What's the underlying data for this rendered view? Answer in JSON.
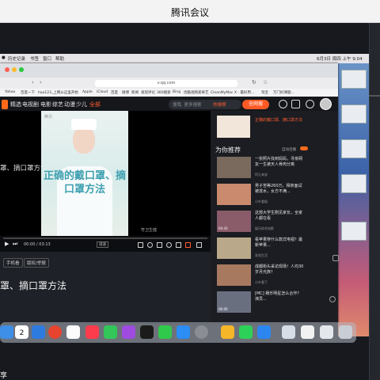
{
  "meeting": {
    "title": "腾讯会议"
  },
  "mac_menubar": {
    "items": [
      "历史记录",
      "书签",
      "窗口",
      "帮助"
    ],
    "clock": "6月3日 周四 上午 9:04"
  },
  "browser": {
    "url": "v.qq.com",
    "bookmarks": [
      "Yahoo",
      "百度一下",
      "hao123_上网从这里开始",
      "Apple",
      "iCloud",
      "百度",
      "微博",
      "新闻",
      "发现评论",
      "360搜索",
      "Bing",
      "优酷视频",
      "爱奇艺",
      "CleanMyMac X - 最好用...",
      "淘宝",
      "万门好课题..."
    ]
  },
  "nav": {
    "items": [
      "精选",
      "电视剧",
      "电影",
      "综艺",
      "动漫",
      "少儿",
      "全部"
    ],
    "search_placeholder": "搜我, 更多搜索",
    "search_hot": "热搜榜",
    "search_button": "全网搜"
  },
  "player": {
    "page_title": "罩、摘口罩方法",
    "video_caption": "正确的戴口罩、摘口罩方法",
    "watermark": "腾讯",
    "corner_label": "符卫生健",
    "time": "00:00 / 03:13",
    "speed": "倍速",
    "progress": 0
  },
  "tags": [
    "手机看",
    "版权/举报"
  ],
  "main_title": "罩、摘口罩方法",
  "sidebar": {
    "current_title": "正确的戴口罩、摘口罩方法",
    "heading": "为你推荐",
    "autoplay": "自动连播",
    "items": [
      {
        "title": "一张照片找到妈妈，寻亲网友一生被天人骨肉分离",
        "meta": "阿九来说",
        "dur": ""
      },
      {
        "title": "男子苦等260万，相亲面试被泼水，女方不满...",
        "meta": "小叶看娱",
        "dur": ""
      },
      {
        "title": "这部大学生刚见家长，全家人都在看",
        "meta": "娱乐综合电影",
        "dur": "04:43"
      },
      {
        "title": "看苹果穿什么款式电视？最新苹果...",
        "meta": "发现生活",
        "dur": ""
      },
      {
        "title": "成都街头采访现场！人均30岁月光族？",
        "meta": "小叶看下",
        "dur": ""
      },
      {
        "title": "[MC] 娱乐明星怎么合作？演员...",
        "meta": "",
        "dur": "06:00"
      }
    ]
  },
  "dock": {
    "calendar_day": "2"
  },
  "bottom_char": "享",
  "colors": {
    "accent": "#ff5a26",
    "page_bg": "#1e2127",
    "meeting_bar": "#f3f3f4"
  }
}
